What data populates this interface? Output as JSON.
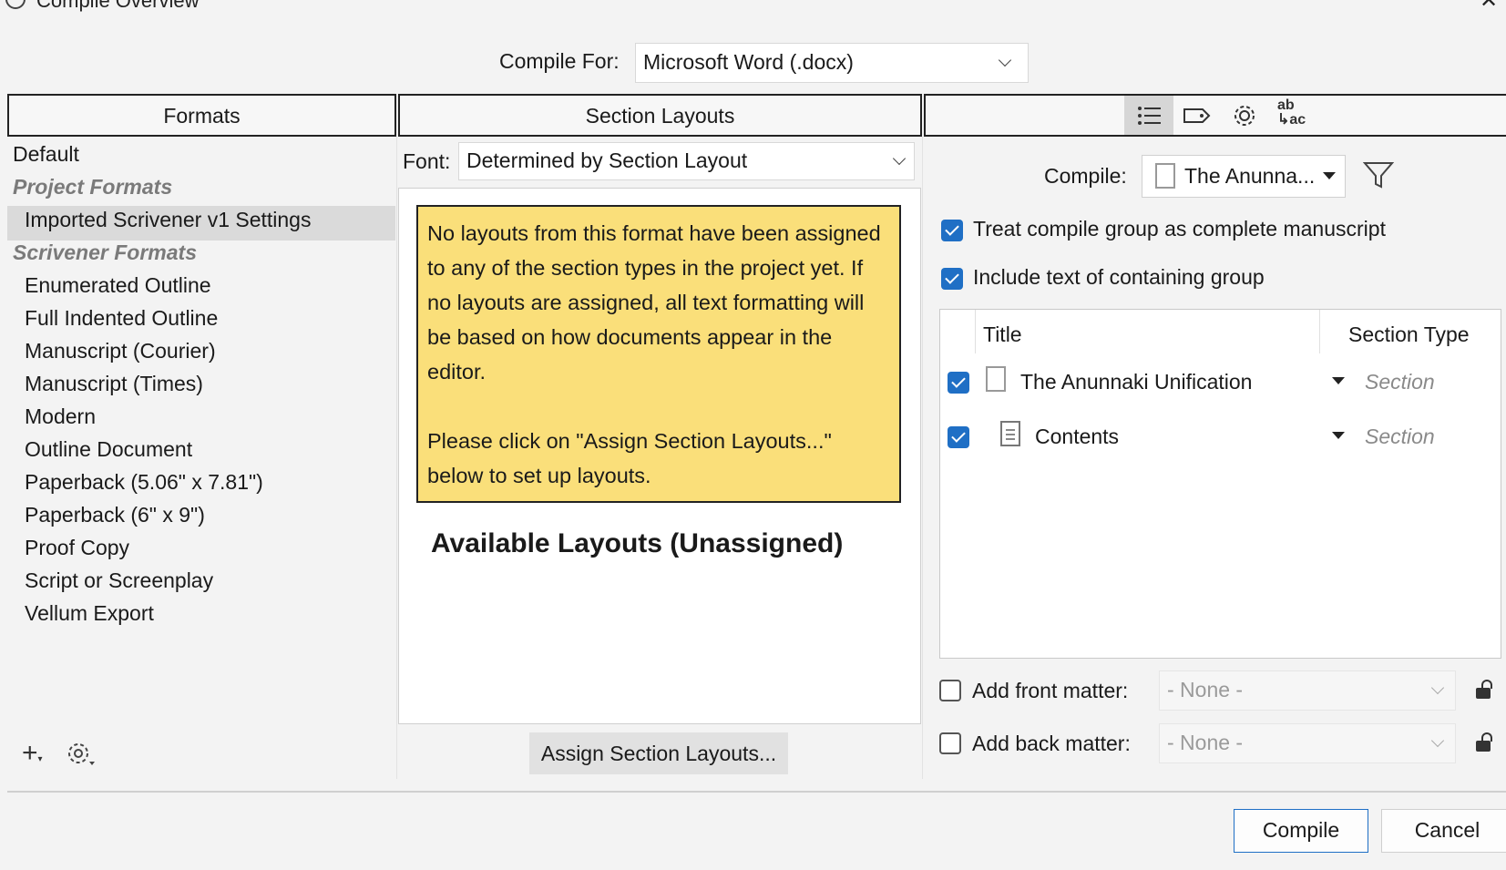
{
  "window": {
    "title": "Compile Overview"
  },
  "compile_for": {
    "label": "Compile For:",
    "value": "Microsoft Word (.docx)"
  },
  "formats": {
    "header": "Formats",
    "default_item": "Default",
    "project_group": "Project Formats",
    "project_items": [
      "Imported Scrivener v1 Settings"
    ],
    "scrivener_group": "Scrivener Formats",
    "scrivener_items": [
      "Enumerated Outline",
      "Full Indented Outline",
      "Manuscript (Courier)",
      "Manuscript (Times)",
      "Modern",
      "Outline Document",
      "Paperback (5.06\" x 7.81\")",
      "Paperback (6\" x 9\")",
      "Proof Copy",
      "Script or Screenplay",
      "Vellum Export"
    ],
    "selected": "Imported Scrivener v1 Settings"
  },
  "section_layouts": {
    "header": "Section Layouts",
    "font_label": "Font:",
    "font_value": "Determined by Section Layout",
    "note_p1": "No layouts from this format have been assigned to any of the section types in the project yet. If no layouts are assigned, all text formatting will be based on how documents appear in the editor.",
    "note_p2": "Please click on \"Assign Section Layouts...\" below to set up layouts.",
    "available_heading": "Available Layouts (Unassigned)",
    "assign_button": "Assign Section Layouts..."
  },
  "contents_panel": {
    "compile_label": "Compile:",
    "compile_value": "The Anunna...",
    "treat_group": {
      "label": "Treat compile group as complete manuscript",
      "checked": true
    },
    "include_text": {
      "label": "Include text of containing group",
      "checked": true
    },
    "table": {
      "col_title": "Title",
      "col_section_type": "Section Type",
      "rows": [
        {
          "title": "The Anunnaki Unification",
          "section_type": "Section",
          "checked": true
        },
        {
          "title": "Contents",
          "section_type": "Section",
          "checked": true
        }
      ]
    },
    "front_matter": {
      "label": "Add front matter:",
      "value": "- None -",
      "checked": false
    },
    "back_matter": {
      "label": "Add back matter:",
      "value": "- None -",
      "checked": false
    }
  },
  "footer": {
    "compile_button": "Compile",
    "cancel_button": "Cancel"
  },
  "icons": [
    "add-format-icon",
    "gear-icon",
    "list-icon",
    "tag-icon",
    "settings-gear-icon",
    "replace-text-icon",
    "filter-icon",
    "lock-icon"
  ],
  "colors": {
    "accent": "#1f6fc5",
    "note_bg": "#fadf7a",
    "selected_row": "#dadada"
  }
}
